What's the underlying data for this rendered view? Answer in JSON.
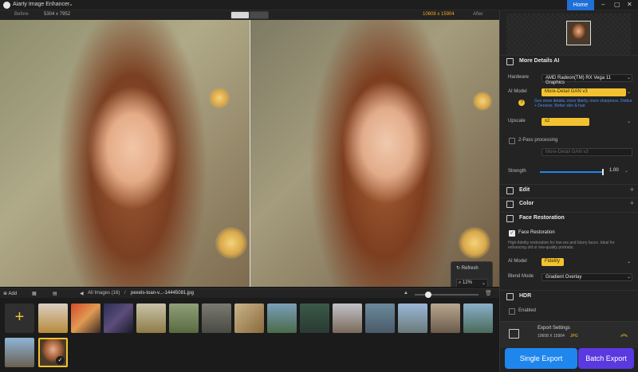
{
  "app": {
    "title": "Aiarty Image Enhancer",
    "home_label": "Home"
  },
  "view": {
    "before_label": "Before",
    "before_size": "5304 x 7952",
    "after_size": "10608 x 15904",
    "after_label": "After"
  },
  "canvas": {
    "refresh_label": "Refresh",
    "zoom": "12%"
  },
  "filmbar": {
    "add_label": "Add",
    "all_images": "All Images (16)",
    "separator": "/",
    "file_name": "pexels-toan-v...-14445081.jpg"
  },
  "panel": {
    "model_section": "More Details AI",
    "hardware_label": "Hardware",
    "hardware_value": "AMD Radeon(TM) RX Vega 11 Graphics",
    "ai_model_label": "AI Model",
    "ai_model_value": "More-Detail GAN  v3",
    "ai_model_hint": "Gen more details, more liberty, more sharpness. Deblur + Denoise. Better skin & hair.",
    "upscale_label": "Upscale",
    "upscale_value": "x2",
    "two_pass_label": "2-Pass processing",
    "two_pass_model": "More-Detail GAN  v3",
    "strength_label": "Strength",
    "strength_value": "1.00",
    "strength_fraction": 1.0,
    "edit_section": "Edit",
    "color_section": "Color",
    "face_section": "Face Restoration",
    "face_checkbox": "Face Restoration",
    "face_desc": "High-fidelity restoration for low-res and blurry faces. Ideal for enhancing old or low-quality portraits.",
    "face_model_label": "AI Model",
    "face_model_value": "Fidelity",
    "blend_label": "Blend Mode",
    "blend_value": "Gradient Overlay",
    "hdr_section": "HDR",
    "hdr_checkbox": "Enabled"
  },
  "export": {
    "title": "Export Settings",
    "resolution": "10608 X 15904",
    "format": "JPG",
    "single_label": "Single Export",
    "batch_label": "Batch Export"
  },
  "colors": {
    "accent": "#f2c230",
    "single_export": "#1f86ee",
    "batch_export": "#5b39e0",
    "home": "#1f6fd8"
  }
}
